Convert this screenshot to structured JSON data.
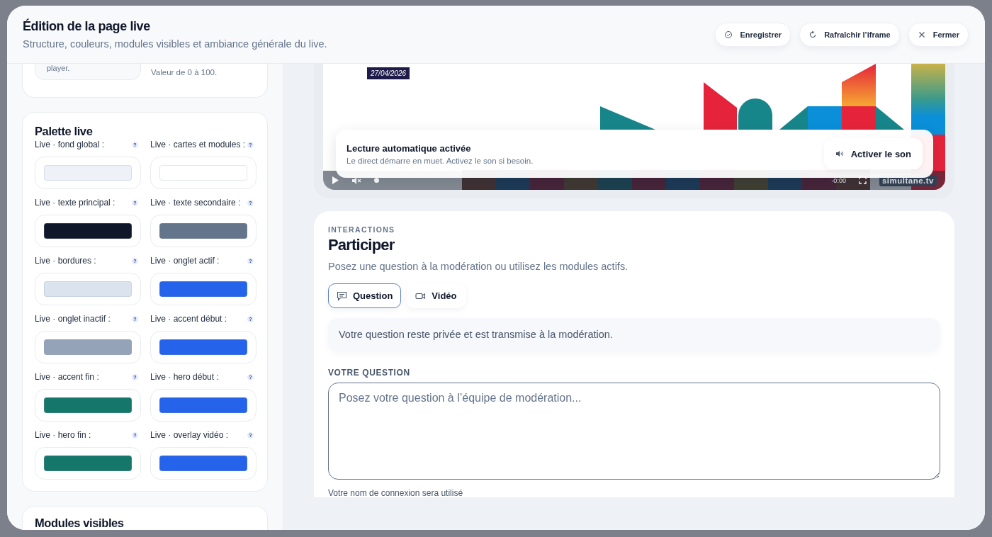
{
  "header": {
    "title": "Édition de la page live",
    "subtitle": "Structure, couleurs, modules visibles et ambiance générale du live.",
    "actions": [
      {
        "label": "Enregistrer",
        "kind": "save"
      },
      {
        "label": "Rafraîchir l’iframe",
        "kind": "refresh"
      },
      {
        "label": "Fermer",
        "kind": "close"
      }
    ]
  },
  "settings_top": {
    "field_text": "player.",
    "hint": "Valeur de 0 à 100."
  },
  "palette": {
    "title": "Palette live",
    "items": [
      {
        "label": "Live · fond global :",
        "help": "?",
        "color": "#eef2f8"
      },
      {
        "label": "Live · cartes et modules :",
        "help": "?",
        "color": "#ffffff"
      },
      {
        "label": "Live · texte principal :",
        "help": "?",
        "color": "#0f172a"
      },
      {
        "label": "Live · texte secondaire :",
        "help": "?",
        "color": "#64748b"
      },
      {
        "label": "Live · bordures :",
        "help": "?",
        "color": "#dbe3ee"
      },
      {
        "label": "Live · onglet actif :",
        "help": "?",
        "color": "#2563eb"
      },
      {
        "label": "Live · onglet inactif :",
        "help": "?",
        "color": "#94a3b8"
      },
      {
        "label": "Live · accent début :",
        "help": "?",
        "color": "#2563eb"
      },
      {
        "label": "Live · accent fin :",
        "help": "?",
        "color": "#14776a"
      },
      {
        "label": "Live · hero début :",
        "help": "?",
        "color": "#2563eb"
      },
      {
        "label": "Live · hero fin :",
        "help": "?",
        "color": "#14776a"
      },
      {
        "label": "Live · overlay vidéo :",
        "help": "?",
        "color": "#2563eb"
      }
    ]
  },
  "modules": {
    "title": "Modules visibles"
  },
  "video": {
    "date": "27/04/2026",
    "notice_title": "Lecture automatique activée",
    "notice_text": "Le direct démarre en muet. Activez le son si besoin.",
    "unmute_button": "Activer le son",
    "time": "-0:00",
    "brand": "simultane.tv"
  },
  "interactions": {
    "eyebrow": "INTERACTIONS",
    "title": "Participer",
    "subtitle": "Posez une question à la modération ou utilisez les modules actifs.",
    "tabs": [
      {
        "label": "Question",
        "kind": "question",
        "selected": true
      },
      {
        "label": "Vidéo",
        "kind": "video",
        "selected": false
      }
    ],
    "info": "Votre question reste privée et est transmise à la modération.",
    "question_label": "VOTRE QUESTION",
    "placeholder": "Posez votre question à l’équipe de modération...",
    "footnote": "Votre nom de connexion sera utilisé"
  }
}
